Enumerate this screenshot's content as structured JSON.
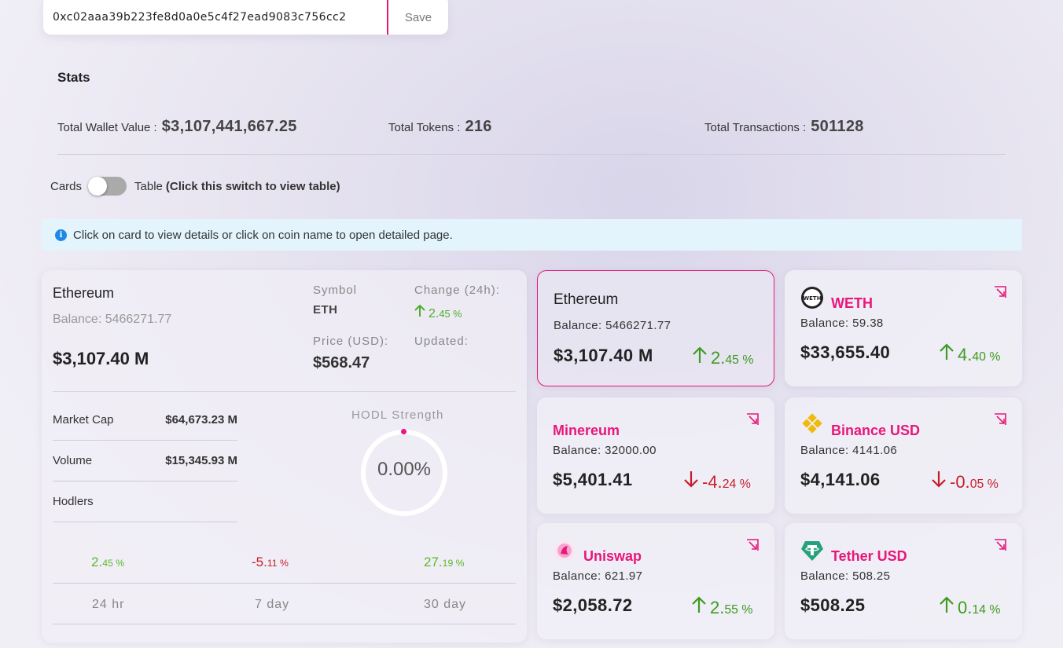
{
  "wallet": {
    "address": "0xc02aaa39b223fe8d0a0e5c4f27ead9083c756cc2",
    "save_label": "Save"
  },
  "stats": {
    "title": "Stats",
    "total_wallet_value_label": "Total Wallet Value :",
    "total_wallet_value": "$3,107,441,667.25",
    "total_tokens_label": "Total Tokens :",
    "total_tokens": "216",
    "total_transactions_label": "Total Transactions :",
    "total_transactions": "501128"
  },
  "view_toggle": {
    "cards_label": "Cards",
    "table_label": "Table",
    "hint": "(Click this switch to view table)",
    "state": "cards"
  },
  "info": {
    "icon": "info-icon",
    "text": "Click on card to view details or click on coin name to open detailed page."
  },
  "detail": {
    "name": "Ethereum",
    "balance": "Balance: 5466271.77",
    "value": "$3,107.40 M",
    "symbol_label": "Symbol",
    "symbol": "ETH",
    "change_label": "Change (24h):",
    "change_int": "2.",
    "change_dec": "45 %",
    "price_label": "Price (USD):",
    "price": "$568.47",
    "updated_label": "Updated:",
    "metrics": [
      {
        "label": "Market Cap",
        "value": "$64,673.23 M"
      },
      {
        "label": "Volume",
        "value": "$15,345.93 M"
      },
      {
        "label": "Hodlers",
        "value": ""
      }
    ],
    "hodl_label": "HODL Strength",
    "hodl_value": "0.00%",
    "hodl_fraction": 0.0,
    "performance": [
      {
        "int": "2.",
        "dec": "45 %",
        "period": "24 hr",
        "dir": "up"
      },
      {
        "int": "-5.",
        "dec": "11 %",
        "period": "7 day",
        "dir": "down"
      },
      {
        "int": "27.",
        "dec": "19 %",
        "period": "30 day",
        "dir": "up"
      }
    ]
  },
  "cards": [
    {
      "name": "Ethereum",
      "balance": "Balance: 5466271.77",
      "value": "$3,107.40 M",
      "change_int": "2.",
      "change_dec": "45 %",
      "dir": "up",
      "logo": "",
      "active": true
    },
    {
      "name": "WETH",
      "balance": "Balance: 59.38",
      "value": "$33,655.40",
      "change_int": "4.",
      "change_dec": "40 %",
      "dir": "up",
      "logo": "weth-logo-icon"
    },
    {
      "name": "Minereum",
      "balance": "Balance: 32000.00",
      "value": "$5,401.41",
      "change_int": "-4.",
      "change_dec": "24 %",
      "dir": "down",
      "logo": ""
    },
    {
      "name": "Binance USD",
      "balance": "Balance: 4141.06",
      "value": "$4,141.06",
      "change_int": "-0.",
      "change_dec": "05 %",
      "dir": "down",
      "logo": "binance-usd-logo-icon"
    },
    {
      "name": "Uniswap",
      "balance": "Balance: 621.97",
      "value": "$2,058.72",
      "change_int": "2.",
      "change_dec": "55 %",
      "dir": "up",
      "logo": "uniswap-logo-icon"
    },
    {
      "name": "Tether USD",
      "balance": "Balance: 508.25",
      "value": "$508.25",
      "change_int": "0.",
      "change_dec": "14 %",
      "dir": "up",
      "logo": "tether-logo-icon"
    }
  ],
  "colors": {
    "accent": "#e8177a",
    "up": "#3d9b1f",
    "down": "#c71c2a",
    "info_bg": "#e3f4fc"
  }
}
